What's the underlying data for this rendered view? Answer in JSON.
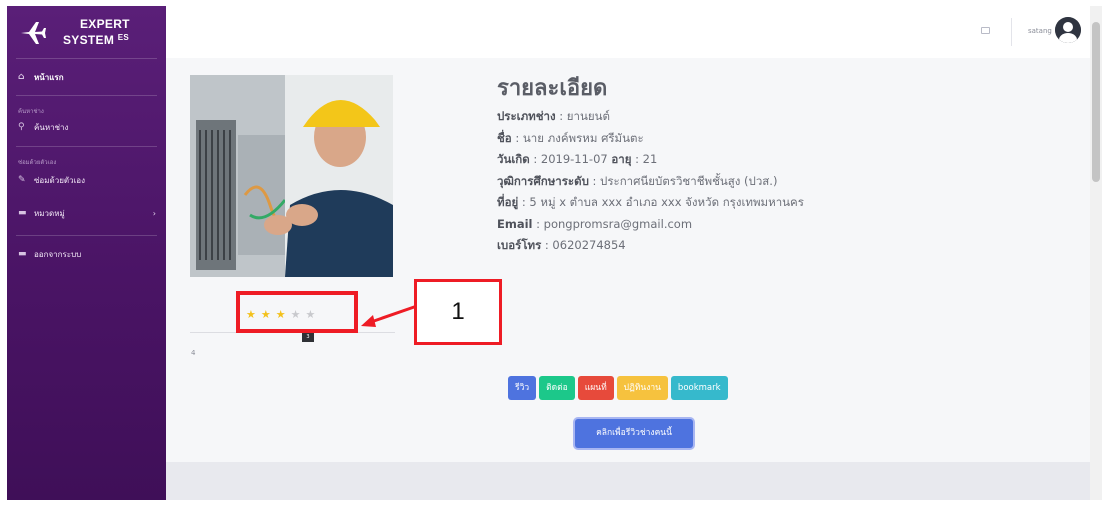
{
  "brand": {
    "line1": "EXPERT",
    "line2": "SYSTEM",
    "sup": "ES"
  },
  "sidebar": {
    "home": "หน้าแรก",
    "heading_search": "ค้นหาช่าง",
    "search": "ค้นหาช่าง",
    "heading_diy": "ซ่อมด้วยตัวเอง",
    "diy": "ซ่อมด้วยตัวเอง",
    "category": "หมวดหมู่",
    "logout": "ออกจากระบบ"
  },
  "topbar": {
    "username": "satang"
  },
  "rating": {
    "value": 3,
    "max": 5,
    "tooltip": "3",
    "text_value": "4"
  },
  "details": {
    "title": "รายละเอียด",
    "type_label": "ประเภทช่าง",
    "type_value": " : ยานยนต์",
    "name_label": "ชื่อ",
    "name_value": " : นาย ภงค์พรหม ศรีมันตะ",
    "birth_label": "วันเกิด",
    "birth_value": " : 2019-11-07 ",
    "age_label": "อายุ",
    "age_value": " : 21",
    "edu_label": "วุฒิการศึกษาระดับ",
    "edu_value": " : ประกาศนียบัตรวิชาชีพชั้นสูง (ปวส.)",
    "addr_label": "ที่อยู่",
    "addr_value": " : 5 หมู่ x ตำบล xxx อำเภอ xxx จังหวัด กรุงเทพมหานคร",
    "email_label": "Email",
    "email_value": " : pongpromsra@gmail.com",
    "phone_label": "เบอร์โทร",
    "phone_value": " : 0620274854"
  },
  "actions": {
    "review": "รีวิว",
    "contact": "ติดต่อ",
    "map": "แผนที่",
    "calendar": "ปฏิทินงาน",
    "bookmark": "bookmark",
    "review_tech": "คลิกเพื่อรีวิวช่างคนนี้"
  },
  "annotation": {
    "label": "1"
  },
  "colors": {
    "sidebar": "#4a1465",
    "primary": "#4e73df",
    "success": "#1cc88a",
    "danger": "#e74a3b",
    "warning": "#f6c23e",
    "info": "#36b9cc",
    "star": "#f3c11b",
    "annotation": "#ee1c25"
  }
}
